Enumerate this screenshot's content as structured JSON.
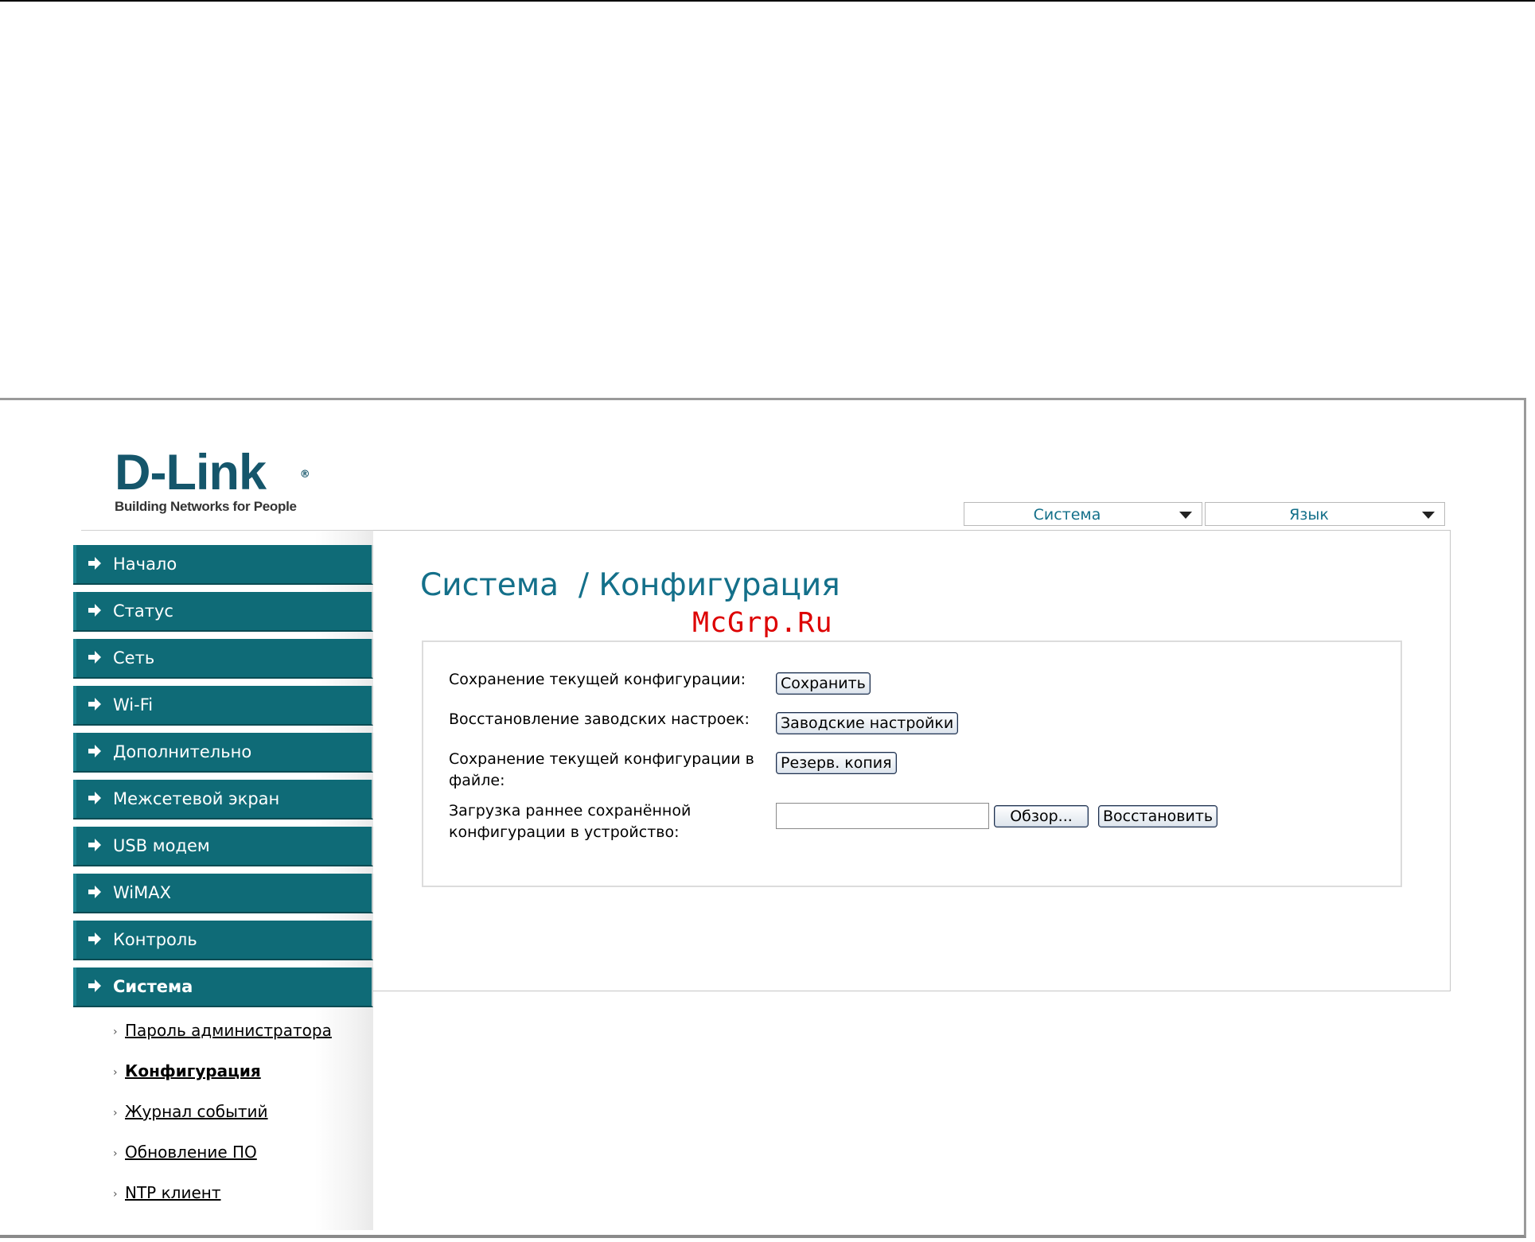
{
  "brand": {
    "logo_text": "D-Link",
    "logo_registered": "®",
    "tagline": "Building Networks for People",
    "logo_color": "#15566b"
  },
  "header": {
    "system_menu": {
      "selected": "Система"
    },
    "language_menu": {
      "selected": "Язык"
    }
  },
  "sidebar": {
    "items": [
      {
        "label": "Начало",
        "icon": "arrow-right-icon"
      },
      {
        "label": "Статус",
        "icon": "arrow-right-icon"
      },
      {
        "label": "Сеть",
        "icon": "arrow-right-icon"
      },
      {
        "label": "Wi-Fi",
        "icon": "arrow-right-icon"
      },
      {
        "label": "Дополнительно",
        "icon": "arrow-right-icon"
      },
      {
        "label": "Межсетевой экран",
        "icon": "arrow-right-icon"
      },
      {
        "label": "USB модем",
        "icon": "arrow-right-icon"
      },
      {
        "label": "WiMAX",
        "icon": "arrow-right-icon"
      },
      {
        "label": "Контроль",
        "icon": "arrow-right-icon"
      },
      {
        "label": "Система",
        "icon": "arrow-right-icon",
        "active": true
      }
    ],
    "subitems": [
      {
        "label": "Пароль администратора"
      },
      {
        "label": "Конфигурация",
        "current": true
      },
      {
        "label": "Журнал событий"
      },
      {
        "label": "Обновление ПО"
      },
      {
        "label": "NTP клиент"
      }
    ],
    "item_color": "#0f6b77"
  },
  "main": {
    "title": "Система  / Конфигурация",
    "watermark": "McGrp.Ru",
    "rows": [
      {
        "label": "Сохранение текущей конфигурации:",
        "button": "Сохранить"
      },
      {
        "label": "Восстановление заводских настроек:",
        "button": "Заводские настройки"
      },
      {
        "label_line1": "Сохранение текущей конфигурации в",
        "label_line2": "файле:",
        "button": "Резерв. копия"
      },
      {
        "label_line1": "Загрузка раннее сохранённой",
        "label_line2": "конфигурации в устройство:",
        "file_value": "",
        "browse_button": "Обзор...",
        "restore_button": "Восстановить"
      }
    ],
    "title_color": "#14708a"
  }
}
